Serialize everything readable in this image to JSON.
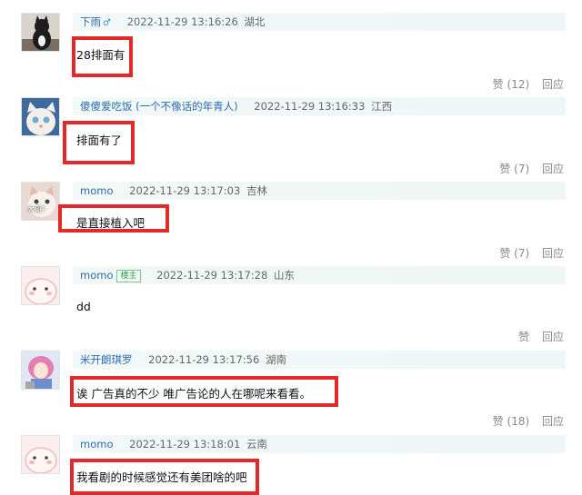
{
  "comments": [
    {
      "avatar_icon": "cat-photo-avatar",
      "user": "下雨",
      "sex_icon": "male-icon",
      "time": "2022-11-29 13:16:26",
      "loc": "湖北",
      "text": "28排面有",
      "like": "赞",
      "likes": "(12)",
      "reply": "回应"
    },
    {
      "avatar_icon": "white-cat-avatar",
      "user": "傻傻爱吃饭",
      "tag": "(一个不像话的年青人)",
      "time": "2022-11-29 13:16:33",
      "loc": "江西",
      "text": "排面有了",
      "like": "赞",
      "likes": "(7)",
      "reply": "回应"
    },
    {
      "avatar_icon": "kitten-avatar",
      "avatar_text": "大哥！",
      "user": "momo",
      "time": "2022-11-29 13:17:03",
      "loc": "吉林",
      "text": "是直接植入吧",
      "like": "赞",
      "likes": "(7)",
      "reply": "回应"
    },
    {
      "avatar_icon": "pink-blob-avatar",
      "user": "momo",
      "badge": "楼主",
      "time": "2022-11-29 13:17:28",
      "loc": "山东",
      "text": "dd",
      "like": "赞",
      "likes": "",
      "reply": "回应"
    },
    {
      "avatar_icon": "anime-girl-avatar",
      "user": "米开朗琪罗",
      "time": "2022-11-29 13:17:56",
      "loc": "湖南",
      "text": "诶 广告真的不少 唯广告论的人在哪呢来看看。",
      "like": "赞",
      "likes": "(18)",
      "reply": "回应"
    },
    {
      "avatar_icon": "pink-blob-avatar",
      "user": "momo",
      "time": "2022-11-29 13:18:01",
      "loc": "云南",
      "text": "我看剧的时候感觉还有美团啥的吧",
      "like": "",
      "likes": "",
      "reply": ""
    }
  ],
  "colors": {
    "highlight": "#e32a2a",
    "username": "#2b6cb0",
    "meta_bg": "#f3f8f8"
  }
}
